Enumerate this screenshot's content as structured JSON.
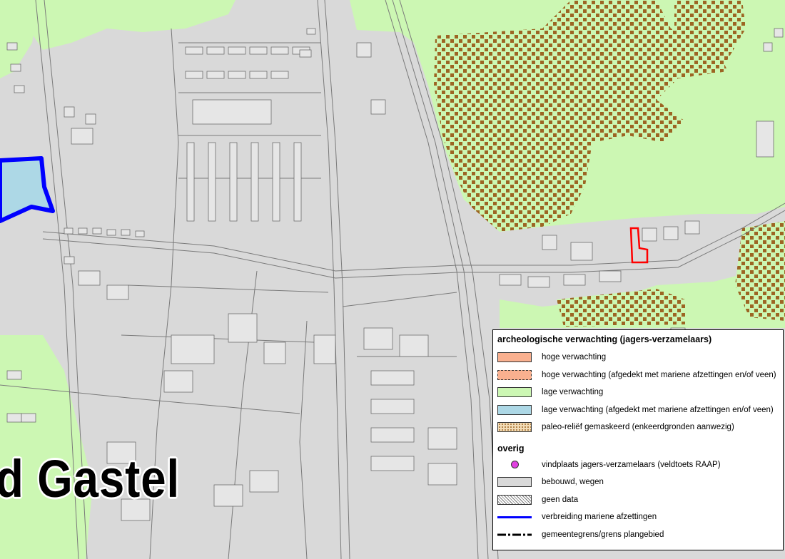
{
  "map": {
    "town_label": "d Gastel",
    "colors": {
      "built": "#d9d9d9",
      "low_expectation": "#ccf7b3",
      "marine_low": "#add8e6",
      "paleo_dot": "#9c6523",
      "boundary_blue": "#0000ff",
      "site_outline_red": "#ff0000",
      "street_lines": "#7a7a7a"
    }
  },
  "legend": {
    "title": "archeologische verwachting (jagers-verzamelaars)",
    "items": [
      {
        "label": "hoge verwachting",
        "swatch": "#f9b08f",
        "style": "solid"
      },
      {
        "label": "hoge verwachting (afgedekt met mariene afzettingen en/of veen)",
        "swatch": "#f9b08f",
        "style": "dashed"
      },
      {
        "label": "lage verwachting",
        "swatch": "#ccf7b3",
        "style": "solid"
      },
      {
        "label": "lage verwachting (afgedekt met mariene afzettingen en/of veen)",
        "swatch": "#add8e6",
        "style": "solid"
      },
      {
        "label": "paleo-reliëf gemaskeerd (enkeerdgronden aanwezig)",
        "swatch": "#f3ddb8",
        "style": "dotted-pattern"
      }
    ],
    "subtitle": "overig",
    "other_items": [
      {
        "label": "vindplaats jagers-verzamelaars (veldtoets RAAP)",
        "symbol": "magenta-dot",
        "color": "#e040e0"
      },
      {
        "label": "bebouwd, wegen",
        "symbol": "grey-box",
        "color": "#d9d9d9"
      },
      {
        "label": "geen data",
        "symbol": "crosshatch-box"
      },
      {
        "label": "verbreiding mariene afzettingen",
        "symbol": "blue-line",
        "color": "#0000ff"
      },
      {
        "label": "gemeentegrens/grens plangebied",
        "symbol": "dash-dot-line",
        "color": "#000000"
      }
    ]
  }
}
